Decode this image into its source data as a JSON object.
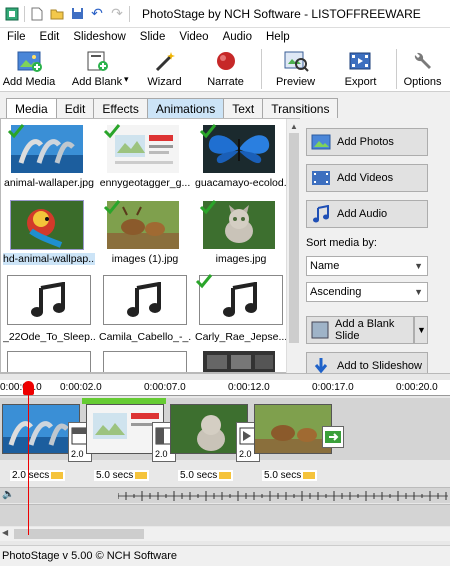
{
  "title": "PhotoStage by NCH Software - LISTOFFREEWARE",
  "menu": [
    "File",
    "Edit",
    "Slideshow",
    "Slide",
    "Video",
    "Audio",
    "Help"
  ],
  "toolbar": {
    "add_media": "Add Media",
    "add_blank": "Add Blank",
    "wizard": "Wizard",
    "narrate": "Narrate",
    "preview": "Preview",
    "export": "Export",
    "options": "Options"
  },
  "tabs": [
    "Media",
    "Edit",
    "Effects",
    "Animations",
    "Text",
    "Transitions"
  ],
  "media": [
    {
      "caption": "animal-wallaper.jpg",
      "checked": true
    },
    {
      "caption": "ennygeotagger_g...",
      "checked": true
    },
    {
      "caption": "guacamayo-ecolod...",
      "checked": true
    },
    {
      "caption": "hd-animal-wallpap...",
      "checked": false
    },
    {
      "caption": "images (1).jpg",
      "checked": true
    },
    {
      "caption": "images.jpg",
      "checked": true
    },
    {
      "caption": "_22Ode_To_Sleep...",
      "checked": false
    },
    {
      "caption": "Camila_Cabello_-_...",
      "checked": false
    },
    {
      "caption": "Carly_Rae_Jepse...",
      "checked": true
    }
  ],
  "side": {
    "add_photos": "Add Photos",
    "add_videos": "Add Videos",
    "add_audio": "Add Audio",
    "sort_label": "Sort media by:",
    "sort_value": "Name",
    "order_value": "Ascending",
    "add_blank_slide": "Add a Blank Slide",
    "add_to_slideshow": "Add to Slideshow"
  },
  "timeline": {
    "ticks": [
      "0:00:00.0",
      "0:00:02.0",
      "0:00:07.0",
      "0:00:12.0",
      "0:00:17.0",
      "0:00:20.0"
    ],
    "clip_durations": [
      "2.0 secs",
      "5.0 secs",
      "5.0 secs",
      "5.0 secs"
    ],
    "transition_durations": [
      "2.0",
      "2.0",
      "2.0"
    ]
  },
  "status": "PhotoStage v 5.00 © NCH Software"
}
